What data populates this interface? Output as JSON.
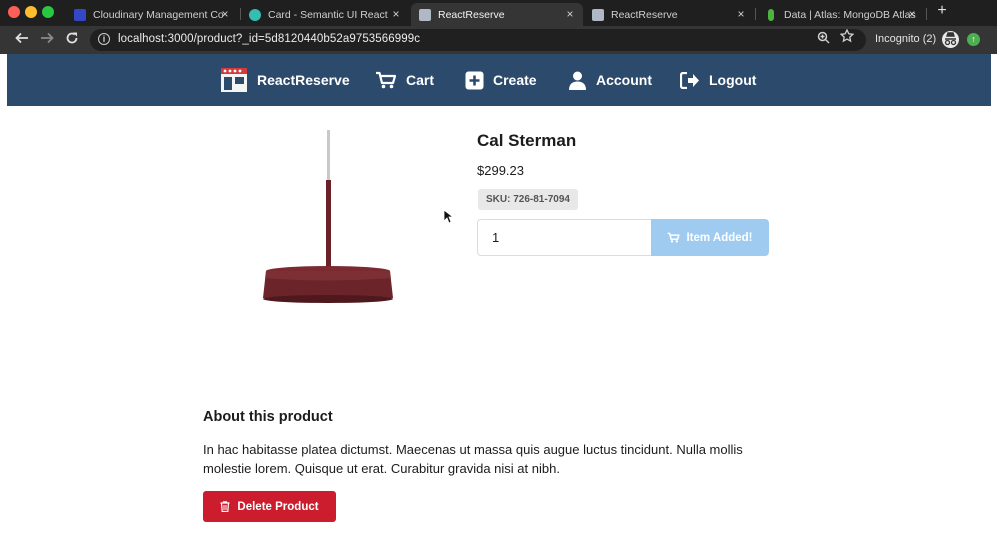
{
  "browser": {
    "tabs": [
      {
        "title": "Cloudinary Management Co",
        "favicon_color": "#3448c5"
      },
      {
        "title": "Card - Semantic UI React",
        "favicon_color": "#35bdb2"
      },
      {
        "title": "ReactReserve",
        "favicon_color": "#b0b8c4",
        "active": true
      },
      {
        "title": "ReactReserve",
        "favicon_color": "#b0b8c4"
      },
      {
        "title": "Data | Atlas: MongoDB Atlas",
        "favicon_color": "#4db33d"
      }
    ],
    "close_glyph": "×",
    "new_tab_glyph": "+",
    "url": "localhost:3000/product?_id=5d8120440b52a9753566999c",
    "incognito_label": "Incognito (2)"
  },
  "nav": {
    "brand": "ReactReserve",
    "cart": "Cart",
    "create": "Create",
    "account": "Account",
    "logout": "Logout",
    "background": "#2c4a6b"
  },
  "product": {
    "name": "Cal Sterman",
    "price": "$299.23",
    "sku": "SKU: 726-81-7094",
    "quantity": "1",
    "add_button_label": "Item Added!",
    "about_heading": "About this product",
    "description": "In hac habitasse platea dictumst. Maecenas ut massa quis augue luctus tincidunt. Nulla mollis molestie lorem. Quisque ut erat. Curabitur gravida nisi at nibh.",
    "delete_button_label": "Delete Product",
    "accent_added": "#9fcbf0",
    "accent_delete": "#cc1d2e"
  }
}
